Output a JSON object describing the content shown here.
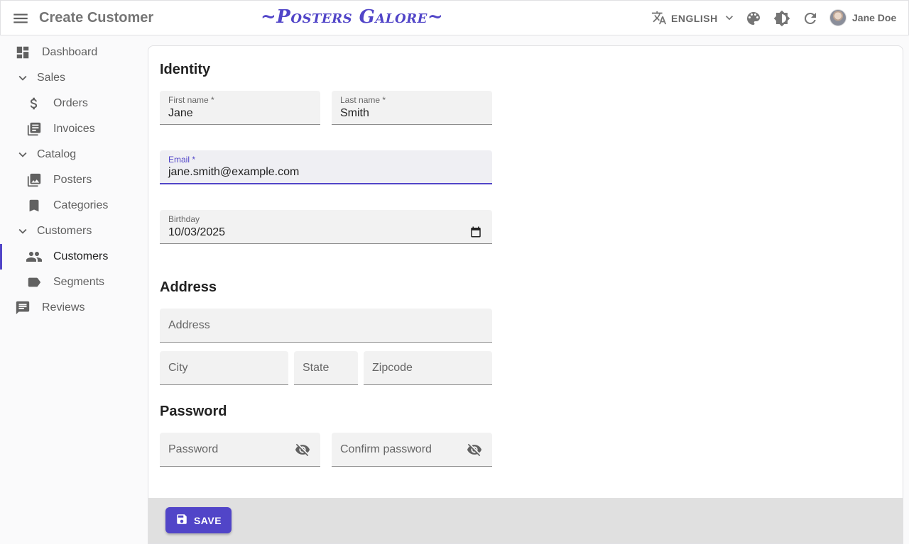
{
  "appbar": {
    "title": "Create Customer",
    "logo": "~Posters Galore~",
    "language": "ENGLISH",
    "user_name": "Jane Doe"
  },
  "sidebar": {
    "items": [
      {
        "label": "Dashboard",
        "icon": "dashboard-icon"
      },
      {
        "label": "Sales",
        "icon": "chevron-down-icon"
      },
      {
        "label": "Orders",
        "icon": "dollar-icon"
      },
      {
        "label": "Invoices",
        "icon": "invoices-icon"
      },
      {
        "label": "Catalog",
        "icon": "chevron-down-icon"
      },
      {
        "label": "Posters",
        "icon": "image-icon"
      },
      {
        "label": "Categories",
        "icon": "bookmark-icon"
      },
      {
        "label": "Customers",
        "icon": "chevron-down-icon"
      },
      {
        "label": "Customers",
        "icon": "people-icon"
      },
      {
        "label": "Segments",
        "icon": "label-icon"
      },
      {
        "label": "Reviews",
        "icon": "comment-icon"
      }
    ]
  },
  "form": {
    "identity_title": "Identity",
    "first_name": {
      "label": "First name *",
      "value": "Jane"
    },
    "last_name": {
      "label": "Last name *",
      "value": "Smith"
    },
    "email": {
      "label": "Email *",
      "value": "jane.smith@example.com"
    },
    "birthday": {
      "label": "Birthday",
      "value": "10/03/2025"
    },
    "address_title": "Address",
    "address": {
      "placeholder": "Address"
    },
    "city": {
      "placeholder": "City"
    },
    "state": {
      "placeholder": "State"
    },
    "zipcode": {
      "placeholder": "Zipcode"
    },
    "password_title": "Password",
    "password": {
      "placeholder": "Password"
    },
    "confirm_password": {
      "placeholder": "Confirm password"
    }
  },
  "toolbar": {
    "save_label": "SAVE"
  },
  "colors": {
    "accent": "#5145c8",
    "toolbar_bg": "#e0e0e0"
  }
}
